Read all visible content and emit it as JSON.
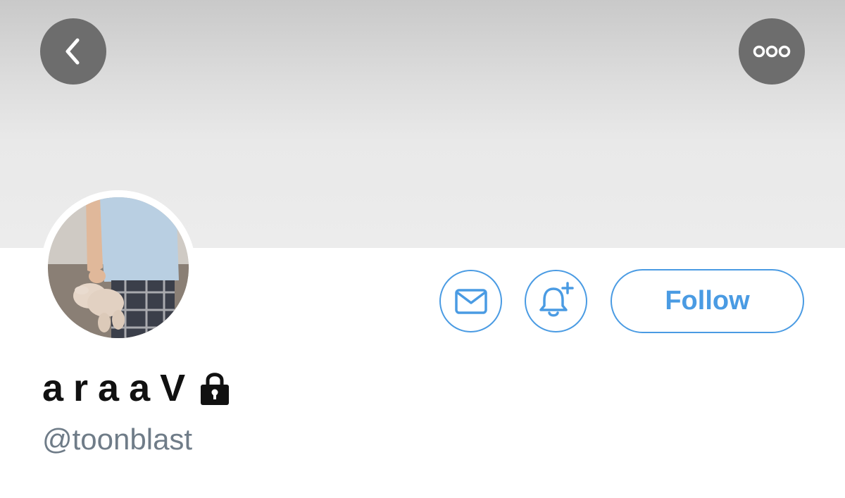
{
  "header": {
    "back_icon": "chevron-left-icon",
    "more_icon": "more-horizontal-icon"
  },
  "profile": {
    "display_name": "araaV",
    "protected_icon": "lock-icon",
    "handle": "@toonblast"
  },
  "actions": {
    "message_icon": "mail-icon",
    "notify_icon": "bell-plus-icon",
    "follow_label": "Follow"
  },
  "colors": {
    "accent": "#4a9be3",
    "handle_text": "#6f7c88",
    "banner_button": "#6d6d6d"
  }
}
